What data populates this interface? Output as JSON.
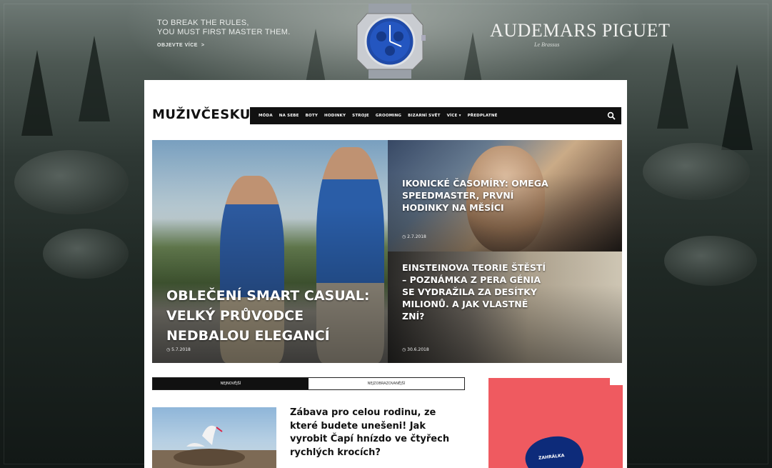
{
  "ad_banner": {
    "tagline_line1": "TO BREAK THE RULES,",
    "tagline_line2": "YOU MUST FIRST MASTER THEM.",
    "cta": "OBJEVTE VÍCE",
    "cta_arrow": ">",
    "brand": "AUDEMARS PIGUET",
    "brand_sub": "Le Brassus"
  },
  "site": {
    "logo": "MUŽIVČESKU"
  },
  "nav": {
    "items": [
      {
        "label": "MÓDA"
      },
      {
        "label": "NA SEBE"
      },
      {
        "label": "BOTY"
      },
      {
        "label": "HODINKY"
      },
      {
        "label": "STROJE"
      },
      {
        "label": "GROOMING"
      },
      {
        "label": "BIZARNÍ SVĚT"
      },
      {
        "label": "VÍCE ▾"
      },
      {
        "label": "PŘEDPLATNÉ"
      }
    ],
    "search_icon": "search-icon"
  },
  "hero": {
    "main": {
      "title": "OBLEČENÍ SMART CASUAL: VELKÝ PRŮVODCE NEDBALOU ELEGANCÍ",
      "date": "◷ 5.7.2018"
    },
    "side1": {
      "title": "IKONICKÉ ČASOMÍRY: OMEGA SPEEDMASTER, PRVNÍ HODINKY NA MĚSÍCI",
      "date": "◷ 2.7.2018"
    },
    "side2": {
      "title": "EINSTEINOVA TEORIE ŠTĚSTÍ – POZNÁMKA Z PERA GÉNIA SE VYDRAŽILA ZA DESÍTKY MILIONŮ. A JAK VLASTNĚ ZNÍ?",
      "date": "◷ 30.6.2018"
    }
  },
  "tabs": [
    {
      "label": "NEJNOVĚJŠÍ",
      "active": true
    },
    {
      "label": "NEJZOBRAZOVANĚJŠÍ",
      "active": false
    }
  ],
  "article": {
    "title": "Zábava pro celou rodinu, ze které budete unešeni! Jak vyrobit Čapí hnízdo ve čtyřech rychlých krocích?"
  },
  "side_ad": {
    "label": "ZAHRÁLKA"
  },
  "colors": {
    "nav_bg": "#111111",
    "ad_bg": "#ef5a60",
    "blob": "#0d2b7a"
  }
}
